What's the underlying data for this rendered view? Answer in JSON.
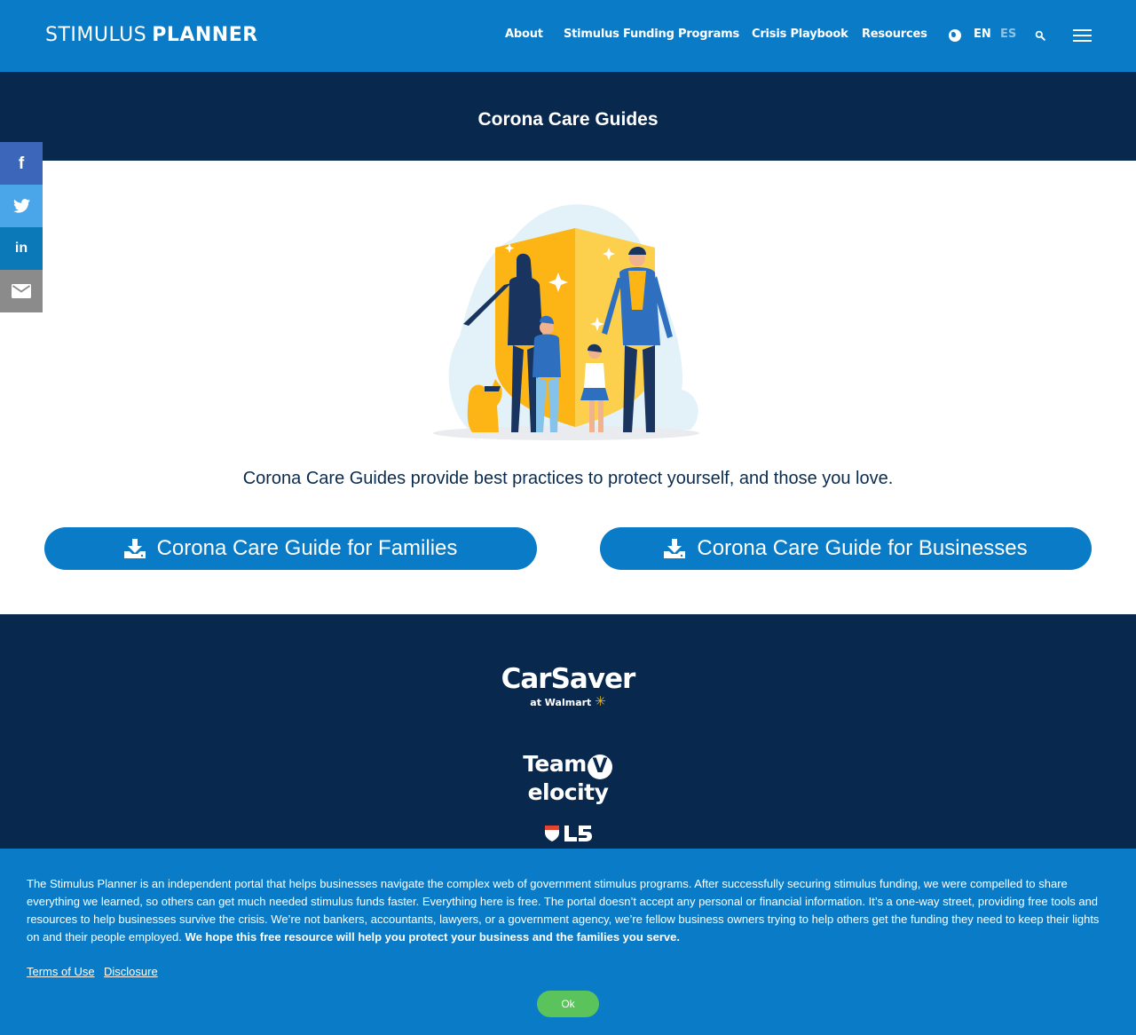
{
  "header": {
    "logo_thin": "STIMULUS",
    "logo_bold": "PLANNER",
    "nav": [
      {
        "label": "About"
      },
      {
        "label": "Stimulus Funding Programs"
      },
      {
        "label": "Crisis Playbook"
      },
      {
        "label": "Resources"
      }
    ],
    "languages": [
      "EN",
      "ES"
    ],
    "active_language": "EN",
    "icons": [
      "globe-icon",
      "search-icon",
      "hamburger-menu-icon"
    ]
  },
  "page": {
    "title": "Corona Care Guides",
    "tagline": "Corona Care Guides provide best practices to protect yourself, and those you love.",
    "buttons": {
      "families": "Corona Care Guide for Families",
      "businesses": "Corona Care Guide for Businesses"
    }
  },
  "share": {
    "items": [
      "facebook",
      "twitter",
      "linkedin",
      "email"
    ],
    "li_label": "in"
  },
  "footer": {
    "partners": {
      "carsaver_name": "CarSaver",
      "carsaver_sub": "at Walmart",
      "team_left": "Team",
      "team_v": "V",
      "team_right": "elocity",
      "l5_label": "L5"
    }
  },
  "cookie": {
    "text": "The Stimulus Planner is an independent portal that helps businesses navigate the complex web of government stimulus programs. After successfully securing stimulus funding, we were compelled to share everything we learned, so others can get much needed stimulus funds faster. Everything here is free. The portal doesn’t accept any personal or financial information. It’s a one-way street, providing free tools and resources to help businesses survive the crisis. We’re not bankers, accountants, lawyers, or a government agency, we’re fellow business owners trying to help others get the funding they need to keep their lights on and their people employed.",
    "bold_text": "We hope this free resource will help you protect your business and the families you serve.",
    "terms": "Terms of Use",
    "disclosure": "Disclosure",
    "ok": "Ok"
  },
  "colors": {
    "header_blue": "#0a7bc7",
    "navy": "#08284e",
    "button_blue": "#0a7bc7",
    "ok_green": "#5bc35b",
    "facebook": "#3b66b9",
    "twitter": "#4aa6e8",
    "linkedin": "#0b79b8",
    "email": "#8b8b8b"
  }
}
